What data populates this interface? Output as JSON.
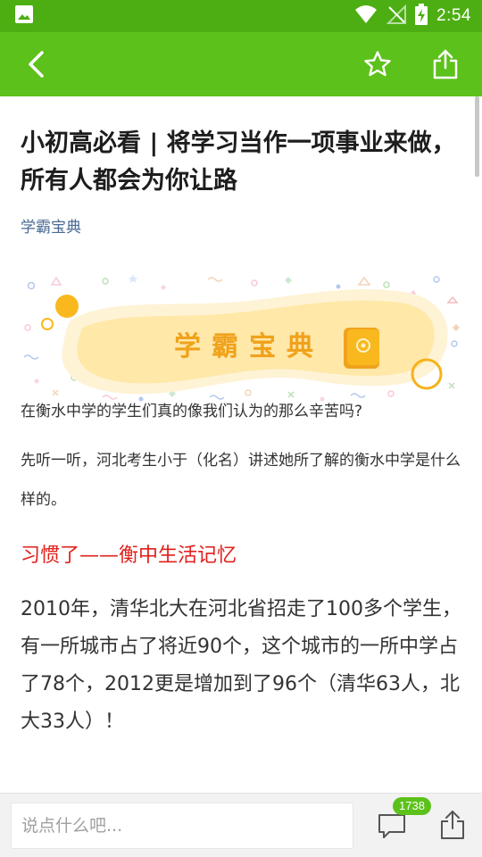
{
  "status_bar": {
    "time": "2:54",
    "icons": [
      "image-icon",
      "wifi-icon",
      "no-signal-icon",
      "battery-charging-icon"
    ]
  },
  "app_bar": {
    "icons": [
      "back-arrow-icon",
      "star-outline-icon",
      "share-icon"
    ]
  },
  "article": {
    "title": "小初高必看 | 将学习当作一项事业来做，所有人都会为你让路",
    "source": "学霸宝典",
    "banner_text": "学霸宝典",
    "paragraph_1": "在衡水中学的学生们真的像我们认为的那么辛苦吗?",
    "paragraph_2": "先听一听，河北考生小于（化名）讲述她所了解的衡水中学是什么样的。",
    "section_heading": "习惯了——衡中生活记忆",
    "paragraph_3": "2010年，清华北大在河北省招走了100多个学生，有一所城市占了将近90个，这个城市的一所中学占了78个，2012更是增加到了96个（清华63人，北大33人）！"
  },
  "bottom_bar": {
    "comment_placeholder": "说点什么吧...",
    "comment_count": "1738",
    "icons": [
      "comment-icon",
      "share-icon"
    ]
  },
  "colors": {
    "status_bar": "#4cae12",
    "app_bar": "#5cc11a",
    "heading_red": "#e0201b",
    "source_blue": "#4a6a94",
    "banner_text": "#f0a21c"
  }
}
